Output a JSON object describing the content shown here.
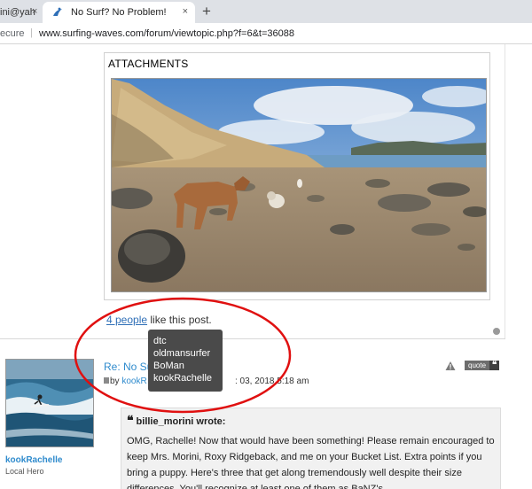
{
  "browser": {
    "inactive_tab_title": "ini@yah",
    "active_tab_title": "No Surf? No Problem!",
    "close_glyph": "×",
    "new_tab_glyph": "+",
    "security_label": "ecure",
    "separator": "|",
    "url": "www.surfing-waves.com/forum/viewtopic.php?f=6&t=36088"
  },
  "post": {
    "attachments_title": "ATTACHMENTS",
    "likes_link": "4 people",
    "likes_suffix": " like this post.",
    "likers": [
      "dtc",
      "oldmansurfer",
      "BoMan",
      "kookRachelle"
    ]
  },
  "reply": {
    "title": "Re: No Sur",
    "by_label": "by ",
    "author": "kookR",
    "date_fragment": ": 03, 2018 5:18 am",
    "quote_label": "quote",
    "quote_icon_glyph": "❝",
    "user": {
      "username": "kookRachelle",
      "rank": "Local Hero"
    },
    "quote": {
      "author_line": "billie_morini wrote:",
      "quote_glyph": "❝",
      "body": "OMG, Rachelle! Now that would have been something! Please remain encouraged to keep Mrs. Morini, Roxy Ridgeback, and me on your Bucket List. Extra points if you bring a puppy. Here's three that get along tremendously well despite their size differences. You'll recognize at least one of them as BaNZ's."
    }
  },
  "colors": {
    "link": "#2f6fb7",
    "username": "#2f8bcd",
    "annotation": "#e01010",
    "tooltip_bg": "#4a4a4a"
  },
  "icons": [
    "surfer-favicon",
    "close-icon",
    "new-tab-icon",
    "warning-icon",
    "quote-icon",
    "scroll-dot-icon"
  ]
}
